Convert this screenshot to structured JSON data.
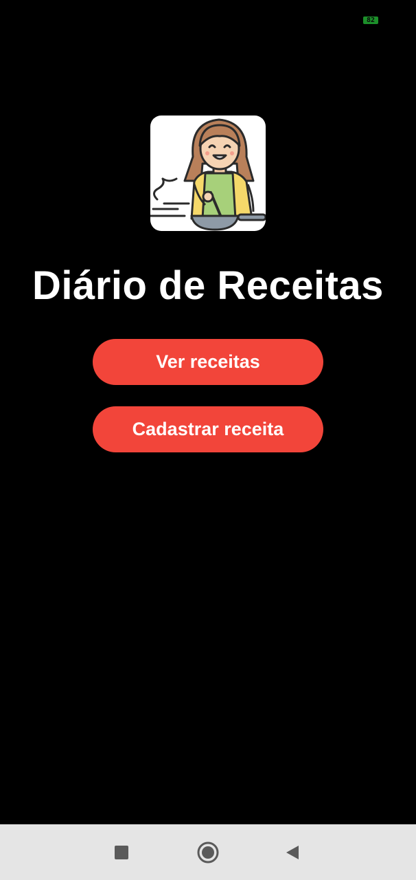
{
  "status_bar": {
    "battery_level": "82",
    "battery_color": "#1c8f2a"
  },
  "app": {
    "logo_icon": "chef-cooking-icon",
    "title": "Diário de Receitas"
  },
  "buttons": {
    "view_recipes": "Ver receitas",
    "register_recipe": "Cadastrar receita",
    "accent_color": "#f2453a"
  },
  "navigation": {
    "recents_icon": "square-icon",
    "home_icon": "circle-icon",
    "back_icon": "triangle-back-icon"
  }
}
